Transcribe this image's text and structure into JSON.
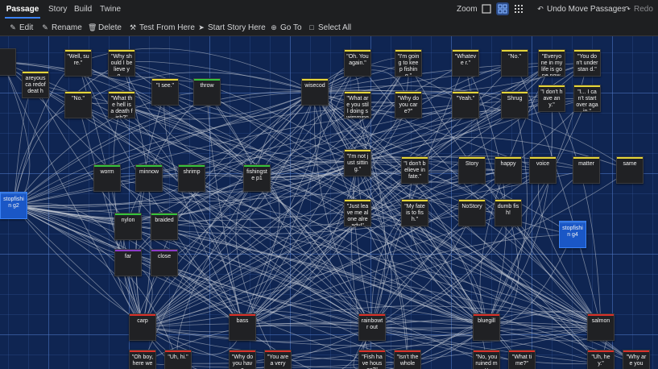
{
  "tabs": [
    "Passage",
    "Story",
    "Build",
    "Twine"
  ],
  "zoom_label": "Zoom",
  "undo_label": "Undo Move Passages",
  "redo_label": "Redo",
  "toolbar": {
    "edit": "Edit",
    "rename": "Rename",
    "delete": "Delete",
    "test_from_here": "Test From Here",
    "start_story_here": "Start Story Here",
    "go_to": "Go To",
    "select_all": "Select All"
  },
  "colors": {
    "yellow": "#e4d53a",
    "green": "#36c23d",
    "red": "#d9312b",
    "purple": "#8b3bc9",
    "blue": "#2f6fd6",
    "canvas": "#0f2552"
  },
  "passages": [
    {
      "id": "p0",
      "text": "",
      "tag": "none"
    },
    {
      "id": "p1",
      "text": "areyousca redofdeat h",
      "tag": "yellow"
    },
    {
      "id": "p2",
      "text": "\"Well, sure.\"",
      "tag": "yellow"
    },
    {
      "id": "p3",
      "text": "\"Why should I believe yo…",
      "tag": "yellow"
    },
    {
      "id": "p4",
      "text": "\"No.\"",
      "tag": "yellow"
    },
    {
      "id": "p5",
      "text": "\"What the hell is a death fish?\"",
      "tag": "yellow"
    },
    {
      "id": "p6",
      "text": "\"I see.\"",
      "tag": "yellow"
    },
    {
      "id": "p7",
      "text": "throw",
      "tag": "green"
    },
    {
      "id": "p8",
      "text": "wisecod",
      "tag": "yellow"
    },
    {
      "id": "p9",
      "text": "\"Oh. You again.\"",
      "tag": "yellow"
    },
    {
      "id": "p10",
      "text": "\"I'm going to keep fishing.\"",
      "tag": "yellow"
    },
    {
      "id": "p11",
      "text": "\"Whateve r.\"",
      "tag": "yellow"
    },
    {
      "id": "p12",
      "text": "\"No.\"",
      "tag": "yellow"
    },
    {
      "id": "p13",
      "text": "\"Everyone in my life is gone now. All",
      "tag": "yellow"
    },
    {
      "id": "p14",
      "text": "\"You don't understan d.\"",
      "tag": "yellow"
    },
    {
      "id": "p15",
      "text": "\"What are you still doing swimming",
      "tag": "yellow"
    },
    {
      "id": "p16",
      "text": "\"Why do you care?\"",
      "tag": "yellow"
    },
    {
      "id": "p17",
      "text": "\"Yeah.\"",
      "tag": "yellow"
    },
    {
      "id": "p18",
      "text": "Shrug",
      "tag": "yellow"
    },
    {
      "id": "p19",
      "text": "\"I don't have any.\"",
      "tag": "yellow"
    },
    {
      "id": "p20",
      "text": "\"I... I can't start over again.\"",
      "tag": "yellow"
    },
    {
      "id": "p21",
      "text": "worm",
      "tag": "green"
    },
    {
      "id": "p22",
      "text": "minnow",
      "tag": "green"
    },
    {
      "id": "p23",
      "text": "shrimp",
      "tag": "green"
    },
    {
      "id": "p24",
      "text": "fishingste p1",
      "tag": "green"
    },
    {
      "id": "p25",
      "text": "\"I'm not just sitting.\"",
      "tag": "yellow"
    },
    {
      "id": "p26",
      "text": "\"I don't believe in fate.\"",
      "tag": "yellow"
    },
    {
      "id": "p27",
      "text": "Story",
      "tag": "yellow"
    },
    {
      "id": "p28",
      "text": "happy",
      "tag": "yellow"
    },
    {
      "id": "p29",
      "text": "voice",
      "tag": "yellow"
    },
    {
      "id": "p30",
      "text": "matter",
      "tag": "yellow"
    },
    {
      "id": "p31",
      "text": "same",
      "tag": "yellow"
    },
    {
      "id": "p32",
      "text": "stopfishin g2",
      "tag": "blue"
    },
    {
      "id": "p33",
      "text": "\"Just leave me alone already!\"",
      "tag": "yellow"
    },
    {
      "id": "p34",
      "text": "\"My fate is to fish.\"",
      "tag": "yellow"
    },
    {
      "id": "p35",
      "text": "NoStory",
      "tag": "yellow"
    },
    {
      "id": "p36",
      "text": "dumb fish!",
      "tag": "yellow"
    },
    {
      "id": "p37",
      "text": "nylon",
      "tag": "green"
    },
    {
      "id": "p38",
      "text": "braided",
      "tag": "green"
    },
    {
      "id": "p39",
      "text": "stopfishin g4",
      "tag": "blue"
    },
    {
      "id": "p40",
      "text": "far",
      "tag": "purple"
    },
    {
      "id": "p41",
      "text": "close",
      "tag": "purple"
    },
    {
      "id": "p42",
      "text": "carp",
      "tag": "red"
    },
    {
      "id": "p43",
      "text": "bass",
      "tag": "red"
    },
    {
      "id": "p44",
      "text": "rainbowtr out",
      "tag": "red"
    },
    {
      "id": "p45",
      "text": "bluegill",
      "tag": "red"
    },
    {
      "id": "p46",
      "text": "salmon",
      "tag": "red"
    },
    {
      "id": "p47",
      "text": "\"Oh boy, here we",
      "tag": "red"
    },
    {
      "id": "p48",
      "text": "\"Uh, hi.\"",
      "tag": "red"
    },
    {
      "id": "p49",
      "text": "\"Why do you have",
      "tag": "red"
    },
    {
      "id": "p50",
      "text": "\"You are a very",
      "tag": "red"
    },
    {
      "id": "p51",
      "text": "\"Fish have houses?\"",
      "tag": "red"
    },
    {
      "id": "p52",
      "text": "\"Isn't the whole",
      "tag": "red"
    },
    {
      "id": "p53",
      "text": "\"No, you ruined my",
      "tag": "red"
    },
    {
      "id": "p54",
      "text": "\"What time?\"",
      "tag": "red"
    },
    {
      "id": "p55",
      "text": "\"Uh, hey.\"",
      "tag": "red"
    },
    {
      "id": "p56",
      "text": "\"Why are you",
      "tag": "red"
    }
  ]
}
